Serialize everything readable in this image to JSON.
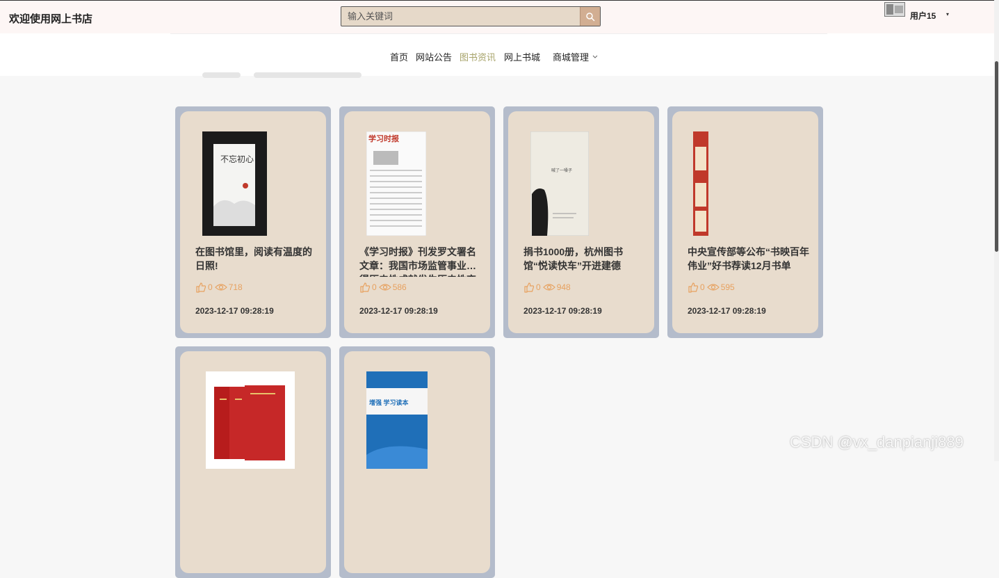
{
  "header": {
    "site_title": "欢迎使用网上书店",
    "search_placeholder": "输入关键词",
    "user_name": "用户15",
    "user_caret": "▾"
  },
  "nav": {
    "items": [
      {
        "label": "首页"
      },
      {
        "label": "网站公告"
      },
      {
        "label": "图书资讯"
      },
      {
        "label": "网上书城"
      },
      {
        "label": "商城管理",
        "chevron": "chevron-down-icon"
      }
    ],
    "active_index": 2,
    "active_color": "#a7a36a"
  },
  "cards": [
    {
      "title": "在图书馆里，阅读有温度的日照!",
      "likes": "0",
      "views": "718",
      "date": "2023-12-17 09:28:19"
    },
    {
      "title": "《学习时报》刊发罗文署名文章：我国市场监管事业…得历史性成就发生历史性变革",
      "likes": "0",
      "views": "586",
      "date": "2023-12-17 09:28:19"
    },
    {
      "title": "捐书1000册，杭州图书馆“悦读快车”开进建德",
      "likes": "0",
      "views": "948",
      "date": "2023-12-17 09:28:19"
    },
    {
      "title": "中央宣传部等公布“书映百年伟业”好书荐读12月书单",
      "likes": "0",
      "views": "595",
      "date": "2023-12-17 09:28:19"
    },
    {
      "title": "",
      "likes": "",
      "views": "",
      "date": ""
    },
    {
      "title": "",
      "likes": "",
      "views": "",
      "date": ""
    }
  ],
  "colors": {
    "card_frame": "#b4bccb",
    "card_bg": "#e8dccd",
    "stat_color": "#e7a15f",
    "search_bg": "#e6d9c9",
    "search_button": "#d2ae92"
  },
  "cover_texts": {
    "book1": "不忘初心",
    "book2": "学习时报",
    "book3": "喊了一嗓子",
    "book6": "增强 学习读本"
  },
  "watermark": "CSDN @vx_danpianji889"
}
